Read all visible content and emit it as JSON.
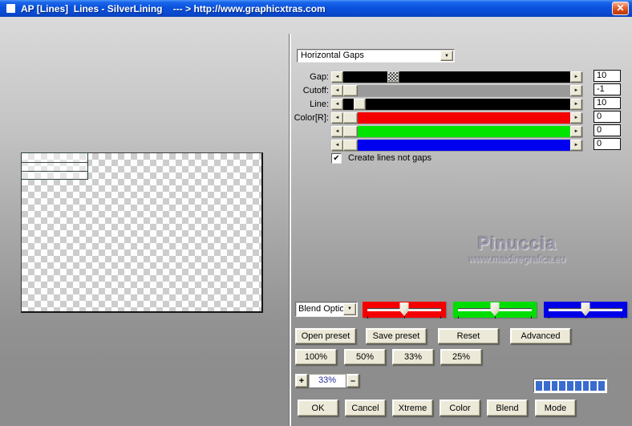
{
  "window": {
    "title": "AP [Lines]  Lines - SilverLining    --- > http://www.graphicxtras.com"
  },
  "icons": {
    "close": "✕",
    "dropdown_arrow": "▼",
    "arrow_left": "◄",
    "arrow_right": "►",
    "check": "✔"
  },
  "filter_panel": {
    "effect_select": {
      "value": "Horizontal Gaps"
    },
    "sliders": [
      {
        "label": "Gap:",
        "value": "10",
        "track_color": "#000000"
      },
      {
        "label": "Cutoff:",
        "value": "-1",
        "track_color": "#9a9a9a"
      },
      {
        "label": "Line:",
        "value": "10",
        "track_color": "#000000"
      },
      {
        "label": "Color[R]:",
        "value": "0",
        "track_color": "#f40000"
      },
      {
        "label": "",
        "value": "0",
        "track_color": "#00e400"
      },
      {
        "label": "",
        "value": "0",
        "track_color": "#0000f0"
      }
    ],
    "checkbox": {
      "label": "Create lines not gaps",
      "checked": true
    }
  },
  "watermark": {
    "name": "Pinuccia",
    "url": "www.maidiregrafica.eu"
  },
  "blend_row": {
    "select_value": "Blend Optio",
    "trackbars": [
      {
        "name": "red",
        "color": "#f40000"
      },
      {
        "name": "green",
        "color": "#00dd00"
      },
      {
        "name": "blue",
        "color": "#0000e8"
      }
    ]
  },
  "buttons": {
    "presets": [
      "Open preset",
      "Save preset",
      "Reset",
      "Advanced"
    ],
    "zoom": [
      "100%",
      "50%",
      "33%",
      "25%"
    ],
    "stepper": {
      "plus": "+",
      "value": "33%",
      "minus": "–"
    },
    "bottom": [
      "OK",
      "Cancel",
      "Xtreme",
      "Color",
      "Blend",
      "Mode"
    ]
  },
  "progress": {
    "segments": 9
  }
}
